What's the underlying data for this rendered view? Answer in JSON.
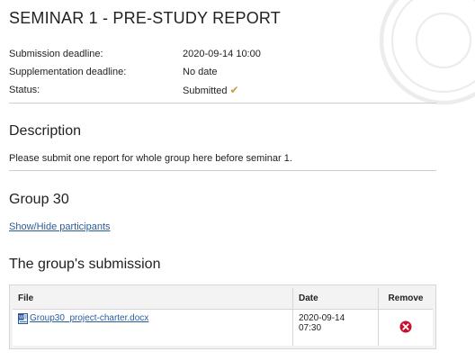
{
  "title": "SEMINAR 1 - PRE-STUDY REPORT",
  "meta": {
    "submission_deadline_label": "Submission deadline:",
    "submission_deadline_value": "2020-09-14 10:00",
    "supplementation_deadline_label": "Supplementation deadline:",
    "supplementation_deadline_value": "No date",
    "status_label": "Status:",
    "status_value": "Submitted",
    "status_icon": "checkmark-icon"
  },
  "description": {
    "heading": "Description",
    "text": "Please submit one report for whole group here before seminar 1."
  },
  "group": {
    "heading": "Group 30",
    "toggle_link": "Show/Hide participants"
  },
  "submission": {
    "heading": "The group's submission",
    "columns": [
      "File",
      "Date",
      "Remove"
    ],
    "rows": [
      {
        "file": "Group30_project-charter.docx",
        "file_icon": "word-document-icon",
        "date_line1": "2020-09-14",
        "date_line2": "07:30",
        "remove_icon": "remove-icon"
      }
    ]
  },
  "colors": {
    "link": "#2a5c9a",
    "check": "#c69a4e",
    "remove": "#c8102e"
  }
}
